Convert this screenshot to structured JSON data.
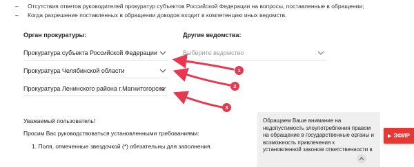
{
  "bullets": [
    "Отсутствия ответов руководителей прокуратур субъектов Российской Федерации на вопросы, поставленные в обращении;",
    "Когда разрешение поставленных в обращении доводов входит в компетенцию иных ведомств."
  ],
  "labels": {
    "prosecutor_office": "Орган прокуратуры:",
    "other_agencies": "Другие ведомства:"
  },
  "selects": {
    "subject_level": "Прокуратура субъекта Российской Федерации",
    "region": "Прокуратура Челябинской области",
    "district": "Прокуратура Ленинского района г.Магнитогорска",
    "agency_placeholder": "Выберите ведомство"
  },
  "annotations": [
    "1",
    "2",
    "3"
  ],
  "body_text": {
    "greeting": "Уважаемый пользователь!",
    "request": "Просим Вас руководствоваться установленными требованиями:",
    "rule_1": "1. Поля, отмеченные звездочкой (*) обязательны для заполнения."
  },
  "notice_lines": [
    "Обращаем Ваше внимание на",
    "недопустимость злоупотребления правом",
    "на обращение в государственные органы и",
    "возможность привлечения к",
    "установленной законом ответственности в"
  ],
  "efir_button": "ЭФИР",
  "colors": {
    "accent_red": "#e53935",
    "arrow_red": "#e8384f",
    "notice_bg": "#efefef"
  }
}
